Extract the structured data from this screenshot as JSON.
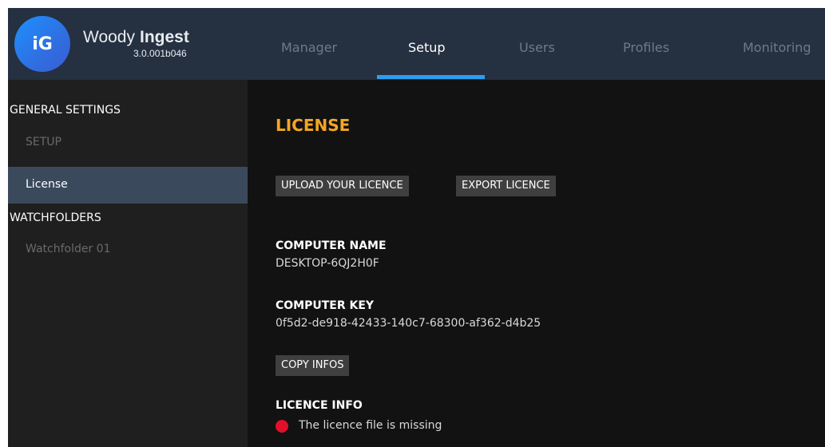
{
  "colors": {
    "header_bg": "#253040",
    "accent_tab": "#2a9ef0",
    "title_orange": "#f5a623",
    "status_red": "#e0102a"
  },
  "header": {
    "logo_text": "iG",
    "app_name_a": "Woody",
    "app_name_b": "Ingest",
    "version": "3.0.001b046",
    "tabs": [
      {
        "label": "Manager",
        "active": false
      },
      {
        "label": "Setup",
        "active": true
      },
      {
        "label": "Users",
        "active": false
      },
      {
        "label": "Profiles",
        "active": false
      },
      {
        "label": "Monitoring",
        "active": false
      }
    ]
  },
  "sidebar": {
    "general_settings": "GENERAL SETTINGS",
    "setup_item": "SETUP",
    "license_item": "License",
    "watchfolders": "WATCHFOLDERS",
    "watchfolder_item": "Watchfolder 01"
  },
  "main": {
    "title": "LICENSE",
    "upload_button": "UPLOAD YOUR LICENCE",
    "export_button": "EXPORT LICENCE",
    "computer_name_label": "COMPUTER NAME",
    "computer_name_value": "DESKTOP-6QJ2H0F",
    "computer_key_label": "COMPUTER KEY",
    "computer_key_value": "0f5d2-de918-42433-140c7-68300-af362-d4b25",
    "copy_button": "COPY INFOS",
    "licence_info_label": "LICENCE INFO",
    "licence_status_text": "The licence file is missing",
    "licence_status_icon": "red-dot-icon"
  }
}
